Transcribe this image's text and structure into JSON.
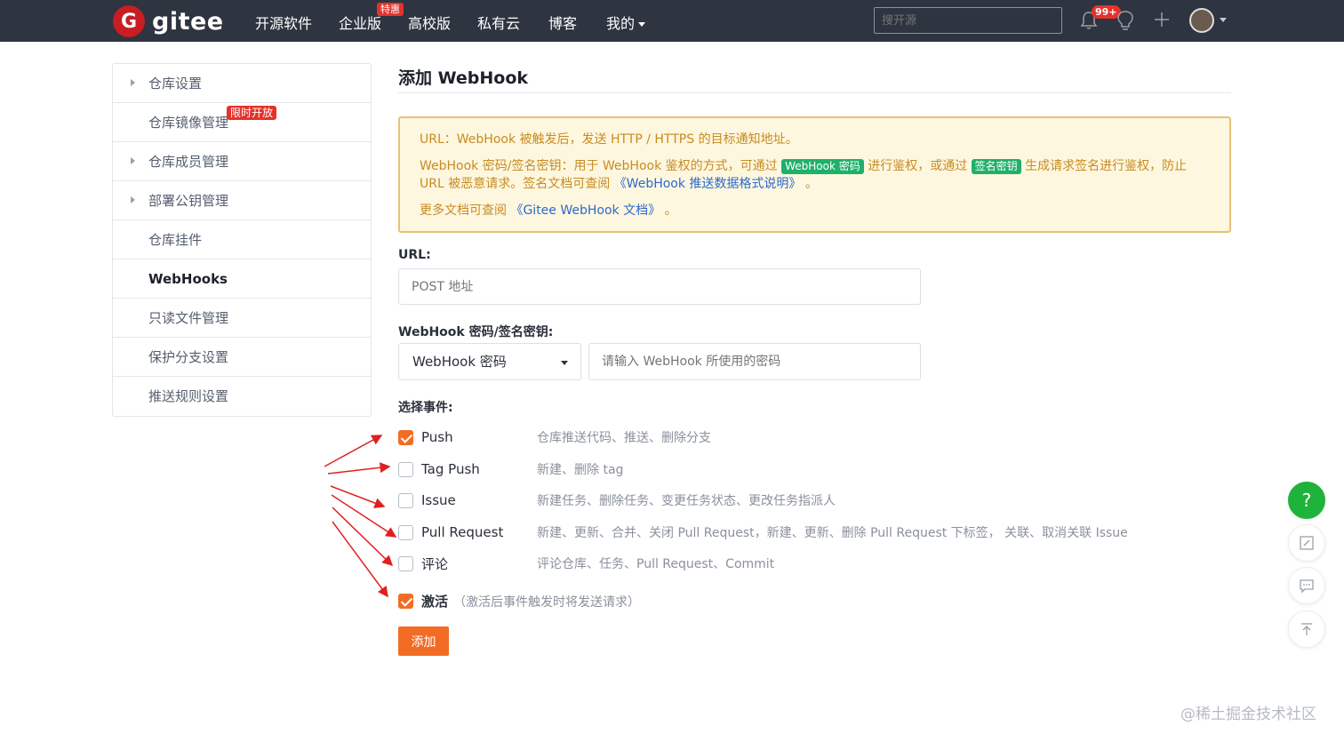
{
  "navbar": {
    "logo_letter": "G",
    "logo_text": "gitee",
    "items": [
      "开源软件",
      "企业版",
      "高校版",
      "私有云",
      "博客",
      "我的"
    ],
    "enterprise_badge": "特惠",
    "search_placeholder": "搜开源",
    "notification_count": "99+"
  },
  "sidebar": {
    "items": [
      {
        "label": "仓库设置"
      },
      {
        "label": "仓库镜像管理",
        "badge": "限时开放"
      },
      {
        "label": "仓库成员管理"
      },
      {
        "label": "部署公钥管理"
      },
      {
        "label": "仓库挂件"
      },
      {
        "label": "WebHooks"
      },
      {
        "label": "只读文件管理"
      },
      {
        "label": "保护分支设置"
      },
      {
        "label": "推送规则设置"
      }
    ]
  },
  "page": {
    "title": "添加 WebHook",
    "notice": {
      "line1": "URL：WebHook 被触发后，发送 HTTP / HTTPS 的目标通知地址。",
      "line2_a": "WebHook 密码/签名密钥：用于 WebHook 鉴权的方式，可通过",
      "tag_password": "WebHook 密码",
      "line2_b": "进行鉴权，或通过",
      "tag_sign": "签名密钥",
      "line2_c": "生成请求签名进行鉴权，防止 URL 被恶意请求。签名文档可查阅",
      "link_format": "《WebHook 推送数据格式说明》",
      "line2_end": "。",
      "line3_a": "更多文档可查阅",
      "link_docs": "《Gitee WebHook 文档》",
      "line3_end": "。"
    },
    "url_label": "URL:",
    "url_placeholder": "POST 地址",
    "secret_label": "WebHook 密码/签名密钥:",
    "secret_select_value": "WebHook 密码",
    "secret_placeholder": "请输入 WebHook 所使用的密码",
    "events_label": "选择事件:",
    "events": [
      {
        "name": "Push",
        "desc": "仓库推送代码、推送、删除分支",
        "checked": true
      },
      {
        "name": "Tag Push",
        "desc": "新建、删除 tag",
        "checked": false
      },
      {
        "name": "Issue",
        "desc": "新建任务、删除任务、变更任务状态、更改任务指派人",
        "checked": false
      },
      {
        "name": "Pull Request",
        "desc": "新建、更新、合并、关闭 Pull Request，新建、更新、删除 Pull Request 下标签， 关联、取消关联 Issue",
        "checked": false
      },
      {
        "name": "评论",
        "desc": "评论仓库、任务、Pull Request、Commit",
        "checked": false
      }
    ],
    "activate_label": "激活",
    "activate_desc": "（激活后事件触发时将发送请求）",
    "activate_checked": true,
    "add_button": "添加"
  },
  "floating": {
    "help_icon": "?"
  },
  "watermark": "@稀土掘金技术社区",
  "colors": {
    "navbar_bg": "#2e3440",
    "brand_red": "#c71d23",
    "accent_orange": "#f36c25",
    "tag_green": "#1fb06a",
    "annotation_red": "#e02020"
  }
}
